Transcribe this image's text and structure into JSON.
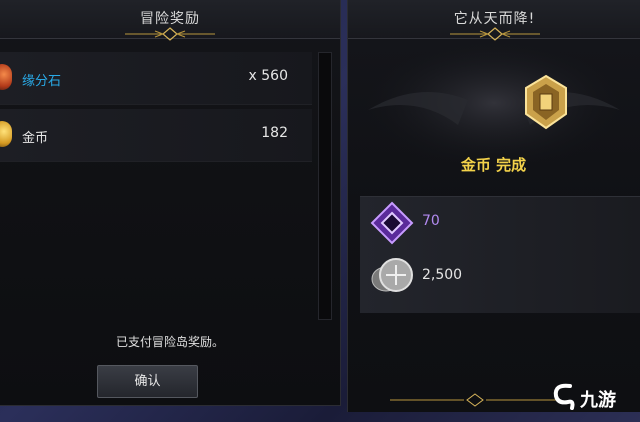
{
  "left_panel": {
    "title": "冒险奖励",
    "items": [
      {
        "name": "缘分石",
        "qty": "x 560",
        "name_color": "#29a9e6",
        "icon": "gem-icon"
      },
      {
        "name": "金币",
        "qty": "182",
        "name_color": "#e6e6e6",
        "icon": "coin-icon"
      }
    ],
    "paid_text": "已支付冒险岛奖励。",
    "confirm_label": "确认"
  },
  "right_panel": {
    "title": "它从天而降!",
    "status": "金币 完成",
    "rewards": [
      {
        "value": "70",
        "icon": "purple-gem-icon",
        "color": "#b28af0"
      },
      {
        "value": "2,500",
        "icon": "coin-stack-icon",
        "color": "#e6e6e6"
      }
    ]
  },
  "watermark": {
    "text": "九游"
  }
}
